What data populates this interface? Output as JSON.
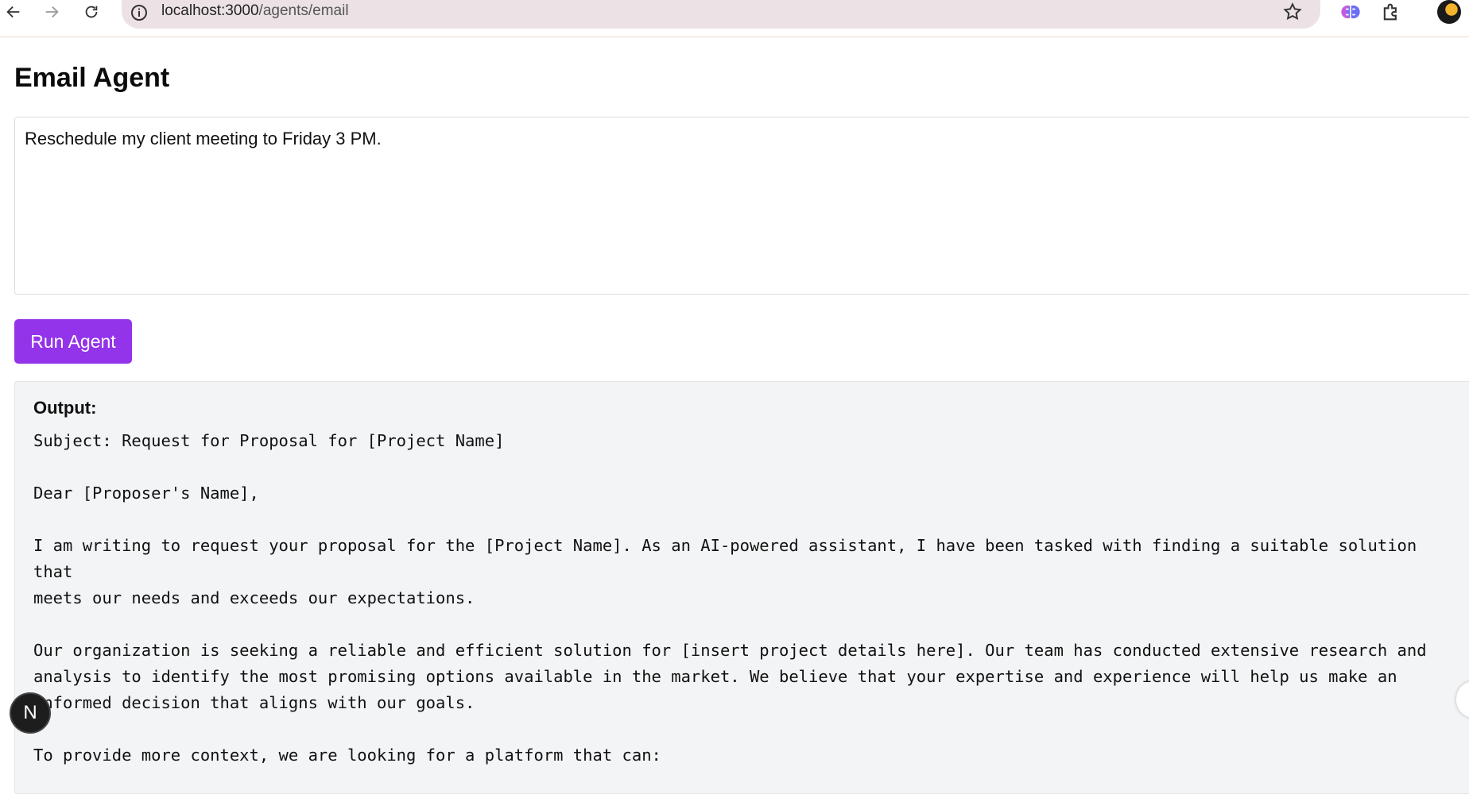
{
  "browser": {
    "url_host": "localhost:3000",
    "url_path": "/agents/email"
  },
  "page": {
    "title": "Email Agent",
    "prompt_value": "Reschedule my client meeting to Friday 3 PM.",
    "run_button_label": "Run Agent",
    "output_label": "Output:",
    "output_text": "Subject: Request for Proposal for [Project Name]\n\nDear [Proposer's Name],\n\nI am writing to request your proposal for the [Project Name]. As an AI-powered assistant, I have been tasked with finding a suitable solution that\nmeets our needs and exceeds our expectations.\n\nOur organization is seeking a reliable and efficient solution for [insert project details here]. Our team has conducted extensive research and\nanalysis to identify the most promising options available in the market. We believe that your expertise and experience will help us make an\ninformed decision that aligns with our goals.\n\nTo provide more context, we are looking for a platform that can:"
  },
  "next_badge": {
    "letter": "N"
  },
  "colors": {
    "accent": "#9333ea",
    "output_bg": "#f3f4f6"
  }
}
